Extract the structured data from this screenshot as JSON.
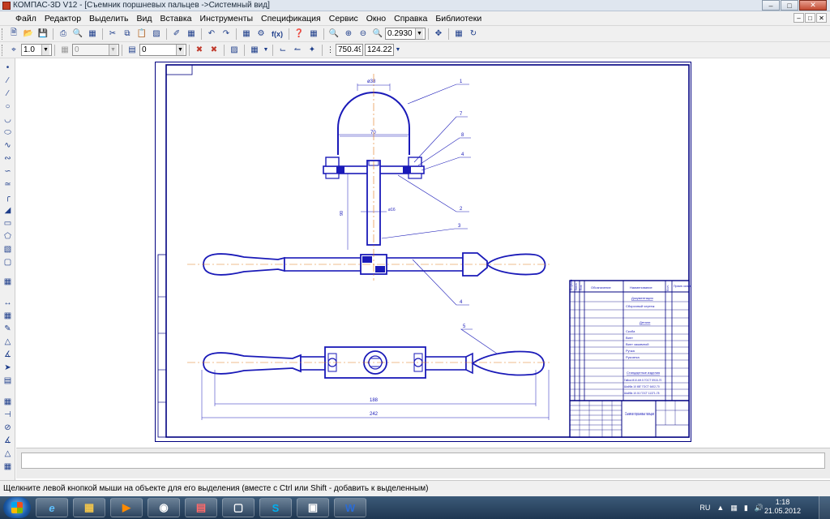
{
  "window": {
    "title": "КОМПАС-3D V12 - [Съемник поршневых пальцев ->Системный вид]"
  },
  "menu": {
    "items": [
      "Файл",
      "Редактор",
      "Выделить",
      "Вид",
      "Вставка",
      "Инструменты",
      "Спецификация",
      "Сервис",
      "Окно",
      "Справка",
      "Библиотеки"
    ]
  },
  "toolbar": {
    "zoom_value": "0.2930",
    "fx_label": "f(x)"
  },
  "props_bar": {
    "scale_value": "1.0",
    "layer_value": "0",
    "style_value": "0",
    "coord_x": "750.495",
    "coord_y": "124.226"
  },
  "drawing": {
    "dim_top_width": "ø38",
    "dim_dome_width": "70",
    "dim_shaft_diam": "ø16",
    "dim_height": "90",
    "dim_handle_inner": "188",
    "dim_handle_total": "242",
    "leaders": [
      "1",
      "7",
      "8",
      "4",
      "2",
      "3",
      "4",
      "5"
    ],
    "title_block": {
      "col_format": "Формат",
      "col_zone": "Зона",
      "col_pos": "Поз.",
      "col_designation": "Обозначение",
      "col_name": "Наименование",
      "col_qty": "Кол.",
      "col_note": "Приме-чание",
      "section_docs": "Документация",
      "doc_assembly": "Сборочный чертеж",
      "section_parts": "Детали",
      "part_1": "Скоба",
      "part_2": "Винт",
      "part_3": "Винт зажимной",
      "part_4": "Ручка",
      "part_5": "Рукоятка",
      "section_standard": "Стандартные изделия",
      "std_1": "Гайка М10-6H.5 ГОСТ 5915-70",
      "std_2": "Шайба 10 65Г ГОСТ 6402-70",
      "std_3": "Шайба 10.01 ГОСТ 11371-78",
      "product_name": "Съемник поршневых пальцев"
    }
  },
  "status": {
    "hint": "Щелкните левой кнопкой мыши на объекте для его выделения (вместе с Ctrl или Shift - добавить к выделенным)"
  },
  "taskbar": {
    "lang": "RU",
    "time": "1:18",
    "date": "21.05.2012",
    "word_label": "W",
    "skype_label": "S"
  },
  "colors": {
    "line": "#1a1ab8",
    "axis": "#e07a1a",
    "frame": "#000080"
  }
}
